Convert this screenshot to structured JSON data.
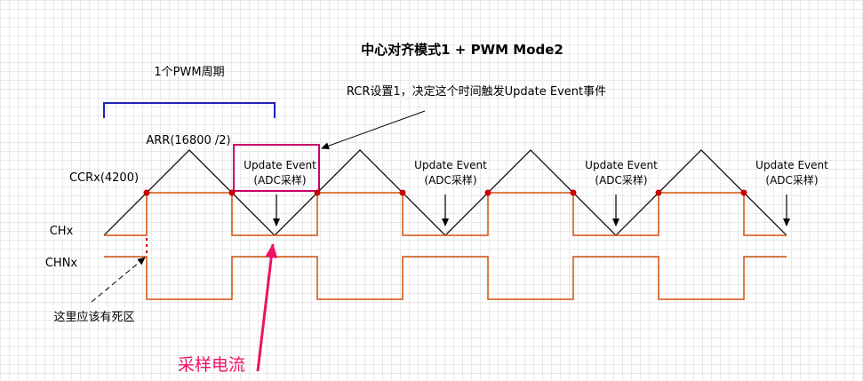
{
  "title": "中心对齐模式1 + PWM Mode2",
  "period_label": "1个PWM周期",
  "rcr_note": "RCR设置1，决定这个时间触发Update Event事件",
  "arr_label": "ARR(16800 /2)",
  "ccrx_label": "CCRx(4200)",
  "chx_label": "CHx",
  "chnx_label": "CHNx",
  "deadtime_note": "这里应该有死区",
  "sampling_label": "采样电流",
  "update_events": [
    {
      "line1": "Update Event",
      "line2": "(ADC采样)"
    },
    {
      "line1": "Update Event",
      "line2": "(ADC采样)"
    },
    {
      "line1": "Update Event",
      "line2": "(ADC采样)"
    },
    {
      "line1": "Update Event",
      "line2": "(ADC采样)"
    }
  ],
  "colors": {
    "signal": "#d4500e",
    "dot": "#cc0000",
    "bracket": "#2222bb",
    "highlight_box": "#c8006a",
    "pink_arrow": "#ee1166",
    "carrier": "#000000"
  }
}
